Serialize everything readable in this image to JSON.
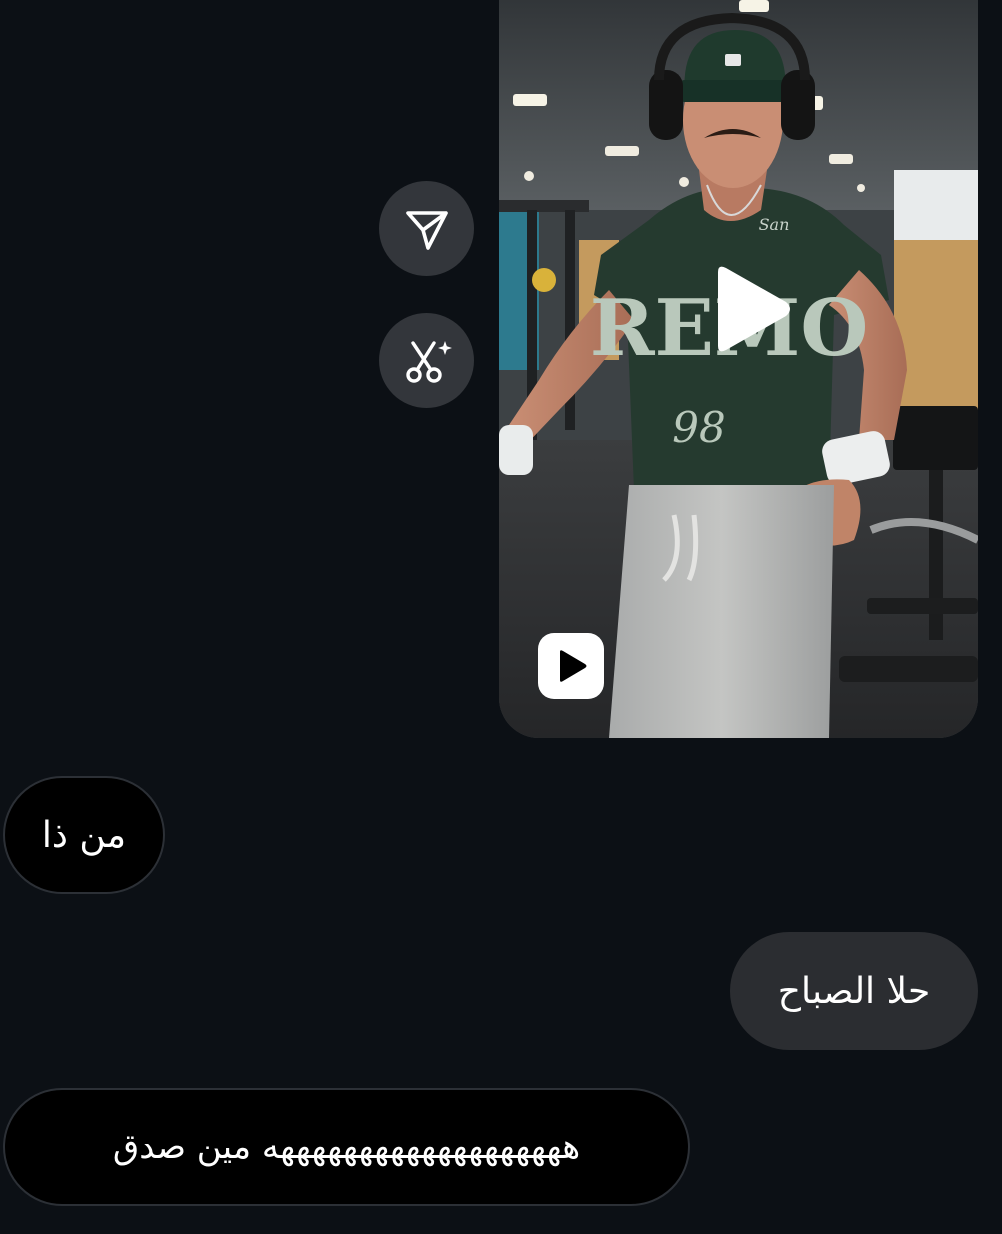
{
  "shared_video": {
    "thumbnail": "gym-video-frame",
    "shirt_text": "REMO",
    "shirt_number": "98",
    "shirt_script": "San",
    "play_icon": "play-icon",
    "reel_icon": "reel-play-icon"
  },
  "actions": [
    {
      "name": "share-button",
      "icon": "send-icon"
    },
    {
      "name": "remix-button",
      "icon": "scissors-sparkle-icon"
    }
  ],
  "messages": [
    {
      "direction": "incoming",
      "text": "من ذا"
    },
    {
      "direction": "outgoing",
      "text": "حلا الصباح"
    },
    {
      "direction": "incoming",
      "text": "هههههههههههههههههههه مين صدق"
    }
  ],
  "colors": {
    "background": "#0c1015",
    "incoming_bubble": "#000000",
    "outgoing_bubble": "#2b2d31",
    "action_button": "#33363b"
  }
}
